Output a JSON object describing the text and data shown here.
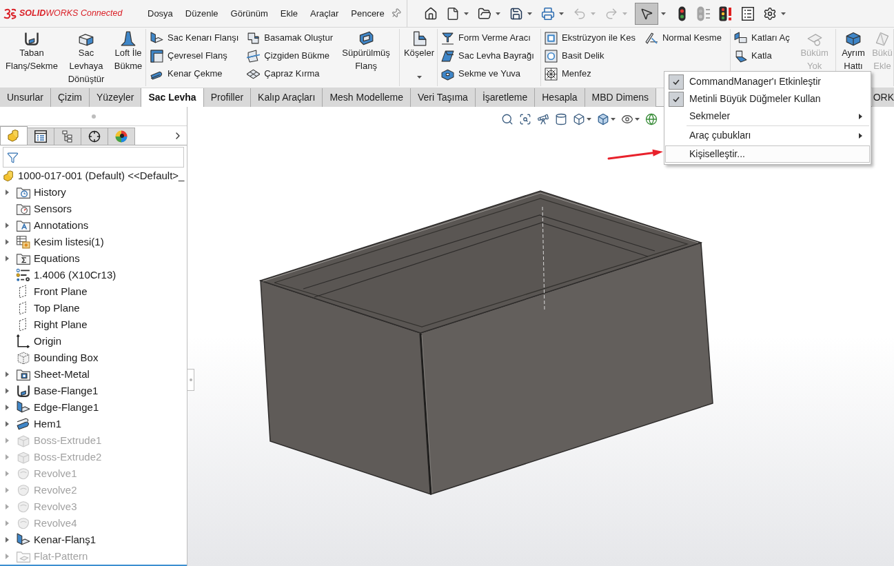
{
  "title_bar": {
    "logo": "**SOLID**WORKS Connected",
    "menus": [
      "Dosya",
      "Düzenle",
      "Görünüm",
      "Ekle",
      "Araçlar",
      "Pencere"
    ]
  },
  "quick_access_toolbar": [
    {
      "selected": false,
      "disabled": false
    },
    {
      "selected": false,
      "disabled": false
    },
    {
      "selected": false,
      "disabled": false
    },
    {
      "selected": false,
      "disabled": false
    },
    {
      "selected": false,
      "disabled": false
    },
    {
      "selected": false,
      "disabled": true
    },
    {
      "selected": false,
      "disabled": true
    },
    {
      "selected": true,
      "disabled": false
    },
    {
      "selected": false,
      "disabled": false
    },
    {
      "selected": false,
      "disabled": true
    },
    {
      "selected": false,
      "disabled": false
    },
    {
      "selected": false,
      "disabled": false
    },
    {
      "selected": false,
      "disabled": false
    }
  ],
  "command_manager": {
    "groups": [
      {
        "columns": [
          {
            "kind": "large",
            "label": "Taban Flanş/Sekme",
            "disabled": false
          },
          {
            "kind": "large",
            "label": "Sac Levhaya Dönüştür",
            "disabled": false
          },
          {
            "kind": "large",
            "label": "Loft İle Bükme",
            "disabled": false
          }
        ]
      },
      {
        "columns": [
          {
            "kind": "stack",
            "items": [
              {
                "label": "Sac Kenarı Flanşı",
                "disabled": false
              },
              {
                "label": "Çevresel Flanş",
                "disabled": false
              },
              {
                "label": "Kenar Çekme",
                "disabled": false
              }
            ]
          },
          {
            "kind": "stack",
            "items": [
              {
                "label": "Basamak Oluştur",
                "disabled": false
              },
              {
                "label": "Çizgiden Bükme",
                "disabled": false
              },
              {
                "label": "Çapraz Kırma",
                "disabled": false
              }
            ]
          },
          {
            "kind": "large",
            "label": "Süpürülmüş Flanş",
            "disabled": false
          }
        ]
      },
      {
        "columns": [
          {
            "kind": "large",
            "label": "Köşeler",
            "disabled": false,
            "dropdown": true
          }
        ]
      },
      {
        "columns": [
          {
            "kind": "stack",
            "items": [
              {
                "label": "Form Verme Aracı",
                "disabled": false
              },
              {
                "label": "Sac Levha Bayrağı",
                "disabled": false
              },
              {
                "label": "Sekme ve Yuva",
                "disabled": false
              }
            ]
          }
        ]
      },
      {
        "columns": [
          {
            "kind": "stack",
            "items": [
              {
                "label": "Ekstrüzyon ile Kes",
                "disabled": false
              },
              {
                "label": "Basit Delik",
                "disabled": false
              },
              {
                "label": "Menfez",
                "disabled": false
              }
            ]
          },
          {
            "kind": "stack",
            "items": [
              {
                "label": "Normal Kesme",
                "disabled": false
              }
            ]
          }
        ]
      },
      {
        "columns": [
          {
            "kind": "stack",
            "items": [
              {
                "label": "Katları Aç",
                "disabled": false
              },
              {
                "label": "Katla",
                "disabled": false
              }
            ]
          },
          {
            "kind": "large",
            "label": "Büküm Yok",
            "disabled": true
          }
        ]
      },
      {
        "columns": [
          {
            "kind": "large",
            "label": "Ayrım Hattı",
            "disabled": false
          },
          {
            "kind": "large",
            "label": "Bükü Ekle",
            "disabled": true
          }
        ]
      }
    ]
  },
  "tabs": [
    {
      "label": "Unsurlar",
      "selected": false
    },
    {
      "label": "Çizim",
      "selected": false
    },
    {
      "label": "Yüzeyler",
      "selected": false
    },
    {
      "label": "Sac Levha",
      "selected": true
    },
    {
      "label": "Profiller",
      "selected": false
    },
    {
      "label": "Kalıp Araçları",
      "selected": false
    },
    {
      "label": "Mesh Modelleme",
      "selected": false
    },
    {
      "label": "Veri Taşıma",
      "selected": false
    },
    {
      "label": "İşaretleme",
      "selected": false
    },
    {
      "label": "Hesapla",
      "selected": false
    },
    {
      "label": "MBD Dimens",
      "selected": false
    },
    {
      "label": "ORK",
      "selected": false
    }
  ],
  "feature_manager": {
    "panel_tabs": [
      {
        "selected": true
      },
      {
        "selected": false
      },
      {
        "selected": false
      },
      {
        "selected": false
      },
      {
        "selected": false
      }
    ],
    "root": "1000-017-001 (Default) <<Default>_",
    "items": [
      {
        "label": "History",
        "kind": "history",
        "expandable": true,
        "suppressed": false
      },
      {
        "label": "Sensors",
        "kind": "sensors",
        "expandable": false,
        "suppressed": false
      },
      {
        "label": "Annotations",
        "kind": "annotations",
        "expandable": true,
        "suppressed": false
      },
      {
        "label": "Kesim listesi(1)",
        "kind": "cutlist",
        "expandable": true,
        "suppressed": false
      },
      {
        "label": "Equations",
        "kind": "equations",
        "expandable": true,
        "suppressed": false
      },
      {
        "label": "1.4006 (X10Cr13)",
        "kind": "material",
        "expandable": false,
        "suppressed": false
      },
      {
        "label": "Front Plane",
        "kind": "plane",
        "expandable": false,
        "suppressed": false
      },
      {
        "label": "Top Plane",
        "kind": "plane",
        "expandable": false,
        "suppressed": false
      },
      {
        "label": "Right Plane",
        "kind": "plane",
        "expandable": false,
        "suppressed": false
      },
      {
        "label": "Origin",
        "kind": "origin",
        "expandable": false,
        "suppressed": false
      },
      {
        "label": "Bounding Box",
        "kind": "bbox",
        "expandable": false,
        "suppressed": false
      },
      {
        "label": "Sheet-Metal",
        "kind": "sheetmetal",
        "expandable": true,
        "suppressed": false
      },
      {
        "label": "Base-Flange1",
        "kind": "base-flange",
        "expandable": true,
        "suppressed": false
      },
      {
        "label": "Edge-Flange1",
        "kind": "edge-flange",
        "expandable": true,
        "suppressed": false
      },
      {
        "label": "Hem1",
        "kind": "hem",
        "expandable": true,
        "suppressed": false
      },
      {
        "label": "Boss-Extrude1",
        "kind": "extrude",
        "expandable": true,
        "suppressed": true
      },
      {
        "label": "Boss-Extrude2",
        "kind": "extrude",
        "expandable": true,
        "suppressed": true
      },
      {
        "label": "Revolve1",
        "kind": "revolve",
        "expandable": true,
        "suppressed": true
      },
      {
        "label": "Revolve2",
        "kind": "revolve",
        "expandable": true,
        "suppressed": true
      },
      {
        "label": "Revolve3",
        "kind": "revolve",
        "expandable": true,
        "suppressed": true
      },
      {
        "label": "Revolve4",
        "kind": "revolve",
        "expandable": true,
        "suppressed": true
      },
      {
        "label": "Kenar-Flanş1",
        "kind": "edge-flange",
        "expandable": true,
        "suppressed": false
      },
      {
        "label": "Flat-Pattern",
        "kind": "flat-pattern",
        "expandable": true,
        "suppressed": true
      }
    ]
  },
  "context_menu": {
    "sections": [
      {
        "items": [
          {
            "label": "CommandManager'ı Etkinleştir",
            "kind": "check",
            "checked": true,
            "highlighted": false
          },
          {
            "label": "Metinli Büyük Düğmeler Kullan",
            "kind": "check",
            "checked": true,
            "highlighted": false
          },
          {
            "label": "Sekmeler",
            "kind": "submenu",
            "highlighted": false
          }
        ]
      },
      {
        "items": [
          {
            "label": "Araç çubukları",
            "kind": "submenu",
            "highlighted": false
          },
          {
            "label": "Kişiselleştir...",
            "kind": "plain",
            "highlighted": true
          }
        ]
      }
    ]
  }
}
